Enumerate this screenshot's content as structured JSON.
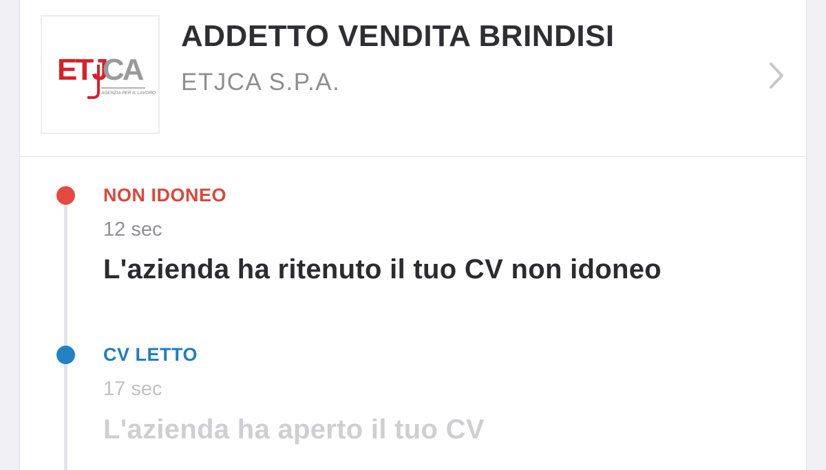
{
  "job": {
    "title": "ADDETTO VENDITA BRINDISI",
    "company": "ETJCA S.P.A.",
    "logo_text": "ETJCA",
    "logo_tagline": "AGENZIA PER IL LAVORO",
    "chevron_icon": "chevron-right-icon"
  },
  "timeline": [
    {
      "status": "NON IDONEO",
      "time": "12 sec",
      "message": "L'azienda ha ritenuto il tuo CV non idoneo",
      "color": "#e5493f"
    },
    {
      "status": "CV LETTO",
      "time": "17 sec",
      "message": "L'azienda ha aperto il tuo CV",
      "color": "#2182c4"
    }
  ],
  "colors": {
    "title": "#2e2e33",
    "subtitle": "#8e8e93",
    "logo_red": "#d8202a",
    "logo_gray": "#9a9a9a"
  }
}
